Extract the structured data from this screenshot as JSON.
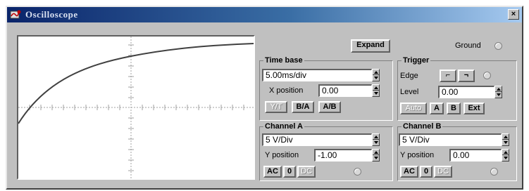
{
  "window": {
    "title": "Oscilloscope",
    "close_glyph": "×",
    "icon": "oscilloscope-app-icon"
  },
  "toolbar": {
    "expand_label": "Expand",
    "ground_label": "Ground"
  },
  "timebase": {
    "title": "Time base",
    "value": "5.00ms/div",
    "xpos_label": "X position",
    "xpos_value": "0.00",
    "modes": [
      "Y/T",
      "B/A",
      "A/B"
    ]
  },
  "trigger": {
    "title": "Trigger",
    "edge_label": "Edge",
    "level_label": "Level",
    "level_value": "0.00",
    "rise_glyph": "⌐",
    "fall_glyph": "¬",
    "sources": [
      "Auto",
      "A",
      "B",
      "Ext"
    ]
  },
  "channel_a": {
    "title": "Channel A",
    "scale": "5 V/Div",
    "ypos_label": "Y position",
    "ypos_value": "-1.00",
    "coupling": [
      "AC",
      "0",
      "DC"
    ]
  },
  "channel_b": {
    "title": "Channel B",
    "scale": "5 V/Div",
    "ypos_label": "Y position",
    "ypos_value": "0.00",
    "coupling": [
      "AC",
      "0",
      "DC"
    ]
  },
  "colors": {
    "trace": "#404040",
    "graticule": "#808080",
    "titlebar": "#0a246a"
  }
}
